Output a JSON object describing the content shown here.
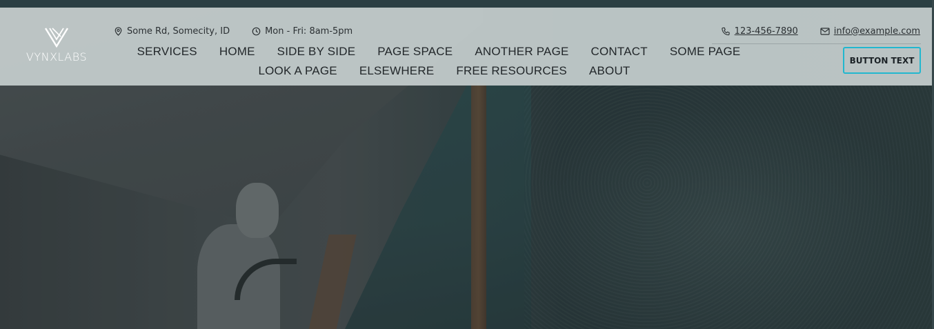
{
  "brand": {
    "name": "VYNXLABS",
    "logo_icon": "vynx-chevron-logo"
  },
  "topbar": {
    "address": {
      "icon": "map-pin-icon",
      "text": "Some Rd, Somecity, ID"
    },
    "hours": {
      "icon": "clock-icon",
      "text": "Mon - Fri: 8am-5pm"
    },
    "phone": {
      "icon": "phone-icon",
      "text": "123-456-7890"
    },
    "email": {
      "icon": "mail-icon",
      "text": "info@example.com"
    }
  },
  "nav": {
    "items": [
      {
        "label": "SERVICES"
      },
      {
        "label": "HOME"
      },
      {
        "label": "SIDE BY SIDE"
      },
      {
        "label": "PAGE SPACE"
      },
      {
        "label": "ANOTHER PAGE"
      },
      {
        "label": "CONTACT"
      },
      {
        "label": "SOME PAGE"
      },
      {
        "label": "LOOK A PAGE"
      },
      {
        "label": "ELSEWHERE"
      },
      {
        "label": "FREE RESOURCES"
      },
      {
        "label": "ABOUT"
      }
    ]
  },
  "cta": {
    "label": "BUTTON TEXT"
  },
  "colors": {
    "accent": "#21b7cf",
    "header_bg": "#c5cdcd",
    "text": "#22272a",
    "top_strip": "#2b3f43"
  }
}
